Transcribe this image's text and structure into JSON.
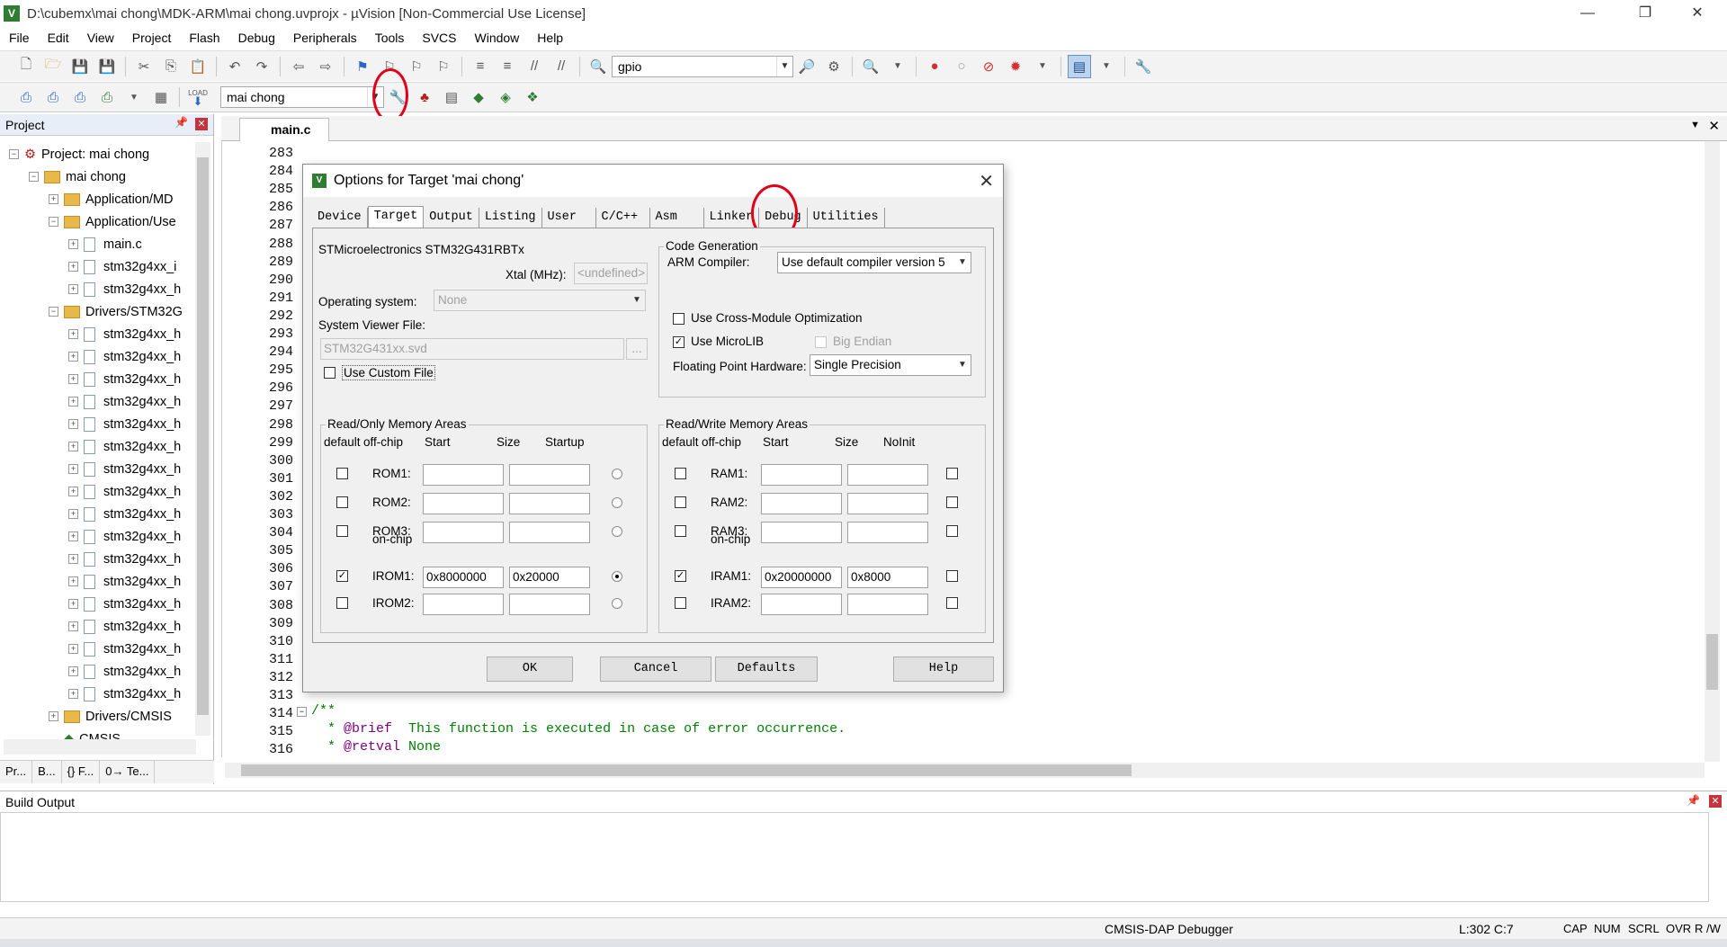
{
  "window": {
    "title": "D:\\cubemx\\mai chong\\MDK-ARM\\mai chong.uvprojx - µVision  [Non-Commercial Use License]",
    "icon_letter": "V"
  },
  "menu": [
    "File",
    "Edit",
    "View",
    "Project",
    "Flash",
    "Debug",
    "Peripherals",
    "Tools",
    "SVCS",
    "Window",
    "Help"
  ],
  "toolbar1": {
    "find_combo_value": "gpio"
  },
  "toolbar2": {
    "target_combo_value": "mai chong",
    "load_label": "LOAD"
  },
  "project_panel": {
    "title": "Project",
    "tree": [
      {
        "indent": 0,
        "toggle": "−",
        "icon": "project",
        "label": "Project: mai chong"
      },
      {
        "indent": 1,
        "toggle": "−",
        "icon": "folder",
        "label": "mai chong"
      },
      {
        "indent": 2,
        "toggle": "+",
        "icon": "folder",
        "label": "Application/MD"
      },
      {
        "indent": 2,
        "toggle": "−",
        "icon": "folder",
        "label": "Application/Use"
      },
      {
        "indent": 3,
        "toggle": "+",
        "icon": "file",
        "label": "main.c"
      },
      {
        "indent": 3,
        "toggle": "+",
        "icon": "file",
        "label": "stm32g4xx_i"
      },
      {
        "indent": 3,
        "toggle": "+",
        "icon": "file",
        "label": "stm32g4xx_h"
      },
      {
        "indent": 2,
        "toggle": "−",
        "icon": "folder",
        "label": "Drivers/STM32G"
      },
      {
        "indent": 3,
        "toggle": "+",
        "icon": "file",
        "label": "stm32g4xx_h"
      },
      {
        "indent": 3,
        "toggle": "+",
        "icon": "file",
        "label": "stm32g4xx_h"
      },
      {
        "indent": 3,
        "toggle": "+",
        "icon": "file",
        "label": "stm32g4xx_h"
      },
      {
        "indent": 3,
        "toggle": "+",
        "icon": "file",
        "label": "stm32g4xx_h"
      },
      {
        "indent": 3,
        "toggle": "+",
        "icon": "file",
        "label": "stm32g4xx_h"
      },
      {
        "indent": 3,
        "toggle": "+",
        "icon": "file",
        "label": "stm32g4xx_h"
      },
      {
        "indent": 3,
        "toggle": "+",
        "icon": "file",
        "label": "stm32g4xx_h"
      },
      {
        "indent": 3,
        "toggle": "+",
        "icon": "file",
        "label": "stm32g4xx_h"
      },
      {
        "indent": 3,
        "toggle": "+",
        "icon": "file",
        "label": "stm32g4xx_h"
      },
      {
        "indent": 3,
        "toggle": "+",
        "icon": "file",
        "label": "stm32g4xx_h"
      },
      {
        "indent": 3,
        "toggle": "+",
        "icon": "file",
        "label": "stm32g4xx_h"
      },
      {
        "indent": 3,
        "toggle": "+",
        "icon": "file",
        "label": "stm32g4xx_h"
      },
      {
        "indent": 3,
        "toggle": "+",
        "icon": "file",
        "label": "stm32g4xx_h"
      },
      {
        "indent": 3,
        "toggle": "+",
        "icon": "file",
        "label": "stm32g4xx_h"
      },
      {
        "indent": 3,
        "toggle": "+",
        "icon": "file",
        "label": "stm32g4xx_h"
      },
      {
        "indent": 3,
        "toggle": "+",
        "icon": "file",
        "label": "stm32g4xx_h"
      },
      {
        "indent": 3,
        "toggle": "+",
        "icon": "file",
        "label": "stm32g4xx_h"
      },
      {
        "indent": 2,
        "toggle": "+",
        "icon": "folder",
        "label": "Drivers/CMSIS"
      },
      {
        "indent": 2,
        "toggle": "",
        "icon": "cmsis",
        "label": "CMSIS"
      }
    ],
    "tabs": [
      "Pr...",
      "B...",
      "{} F...",
      "0→ Te..."
    ]
  },
  "editor": {
    "tab_label": "main.c",
    "line_numbers": [
      "283",
      "284",
      "285",
      "286",
      "287",
      "288",
      "289",
      "290",
      "291",
      "292",
      "293",
      "294",
      "295",
      "296",
      "297",
      "298",
      "299",
      "300",
      "301",
      "302",
      "303",
      "304",
      "305",
      "306",
      "307",
      "308",
      "309",
      "310",
      "311",
      "312",
      "313",
      "314",
      "315",
      "316"
    ],
    "code": {
      "l314": "/**",
      "l315_star": "  * ",
      "l315_tag": "@brief",
      "l315_text": "  This function is executed in case of error occurrence.",
      "l316_star": "  * ",
      "l316_tag": "@retval",
      "l316_text": " None"
    }
  },
  "build_output": {
    "title": "Build Output"
  },
  "status": {
    "debugger": "CMSIS-DAP Debugger",
    "position": "L:302 C:7",
    "indicators": [
      "CAP",
      "NUM",
      "SCRL",
      "OVR",
      "R /W"
    ]
  },
  "dialog": {
    "title": "Options for Target 'mai chong'",
    "tabs": [
      "Device",
      "Target",
      "Output",
      "Listing",
      "User",
      "C/C++",
      "Asm",
      "Linker",
      "Debug",
      "Utilities"
    ],
    "active_tab": "Target",
    "device_name": "STMicroelectronics STM32G431RBTx",
    "xtal_label": "Xtal (MHz):",
    "xtal_value": "<undefined>",
    "os_label": "Operating system:",
    "os_value": "None",
    "svd_label": "System Viewer File:",
    "svd_value": "STM32G431xx.svd",
    "svd_browse": "...",
    "use_custom_file": "Use Custom File",
    "code_gen": {
      "title": "Code Generation",
      "compiler_label": "ARM Compiler:",
      "compiler_value": "Use default compiler version 5",
      "cross_module": "Use Cross-Module Optimization",
      "microlib": "Use MicroLIB",
      "big_endian": "Big Endian",
      "fph_label": "Floating Point Hardware:",
      "fph_value": "Single Precision"
    },
    "rom": {
      "title": "Read/Only Memory Areas",
      "headers": [
        "default",
        "off-chip",
        "Start",
        "Size",
        "Startup"
      ],
      "onchip_label": "on-chip",
      "rows": [
        {
          "label": "ROM1:",
          "start": "",
          "size": "",
          "default": false,
          "startup": false
        },
        {
          "label": "ROM2:",
          "start": "",
          "size": "",
          "default": false,
          "startup": false
        },
        {
          "label": "ROM3:",
          "start": "",
          "size": "",
          "default": false,
          "startup": false
        },
        {
          "label": "IROM1:",
          "start": "0x8000000",
          "size": "0x20000",
          "default": true,
          "startup": true
        },
        {
          "label": "IROM2:",
          "start": "",
          "size": "",
          "default": false,
          "startup": false
        }
      ]
    },
    "ram": {
      "title": "Read/Write Memory Areas",
      "headers": [
        "default",
        "off-chip",
        "Start",
        "Size",
        "NoInit"
      ],
      "onchip_label": "on-chip",
      "rows": [
        {
          "label": "RAM1:",
          "start": "",
          "size": "",
          "default": false
        },
        {
          "label": "RAM2:",
          "start": "",
          "size": "",
          "default": false
        },
        {
          "label": "RAM3:",
          "start": "",
          "size": "",
          "default": false
        },
        {
          "label": "IRAM1:",
          "start": "0x20000000",
          "size": "0x8000",
          "default": true
        },
        {
          "label": "IRAM2:",
          "start": "",
          "size": "",
          "default": false
        }
      ]
    },
    "buttons": {
      "ok": "OK",
      "cancel": "Cancel",
      "defaults": "Defaults",
      "help": "Help"
    }
  },
  "colors": {
    "code_comment": "#008000",
    "code_keyword": "#800080",
    "annotation": "#e0001a",
    "title_icon": "#2e7d32"
  }
}
